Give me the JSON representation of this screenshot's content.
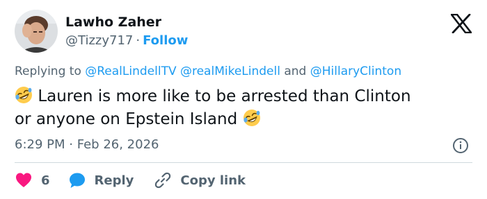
{
  "author": {
    "display_name": "Lawho Zaher",
    "handle": "@Tizzy717",
    "separator": "·",
    "follow_label": "Follow"
  },
  "reply_context": {
    "prefix": "Replying to",
    "mention_1": "@RealLindellTV",
    "mention_2": "@realMikeLindell",
    "conjunction": "and",
    "mention_3": "@HillaryClinton"
  },
  "tweet": {
    "line_1": "Lauren is more like to be arrested than  Clinton",
    "line_2": "or anyone on Epstein Island",
    "emoji": "rolling-on-the-floor-laughing"
  },
  "meta": {
    "time": "6:29 PM",
    "separator": "·",
    "date": "Feb 26, 2026"
  },
  "actions": {
    "like_count": "6",
    "reply_label": "Reply",
    "copy_link_label": "Copy link"
  },
  "colors": {
    "text": "#0f1419",
    "secondary": "#536471",
    "link": "#1d9bf0",
    "heart": "#f91880",
    "reply_bubble": "#1d9bf0",
    "divider": "#cfd9de"
  }
}
